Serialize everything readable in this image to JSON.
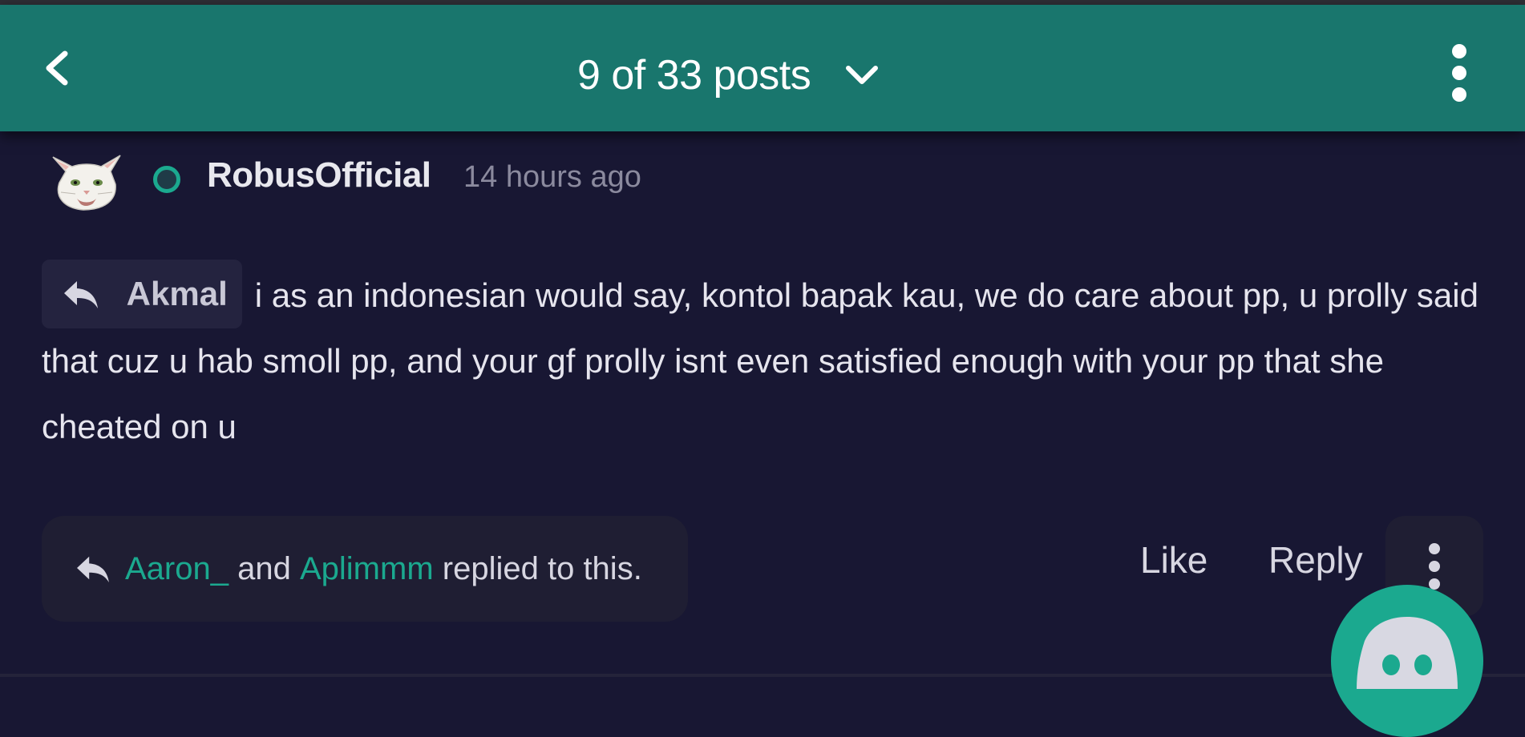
{
  "header": {
    "title": "9 of 33 posts",
    "back_icon": "chevron-left-icon",
    "dropdown_icon": "chevron-down-icon",
    "more_icon": "vertical-ellipsis-icon",
    "background_color": "#19766d"
  },
  "post": {
    "author": "RobusOfficial",
    "time": "14 hours ago",
    "avatar": "white-cat-avatar",
    "status_color": "#1ba98f",
    "reply_to": {
      "icon": "reply-arrow-icon",
      "name": "Akmal"
    },
    "text": "i as an indonesian would say, kontol bapak kau, we do care about pp, u prolly said that cuz u hab smoll pp, and your gf prolly isnt even satisfied enough with your pp that she cheated on u",
    "replies": {
      "icon": "reply-arrow-icon",
      "users": [
        "Aaron_",
        "Aplimmm"
      ],
      "connector": "and",
      "suffix": "replied to this."
    },
    "actions": {
      "like": "Like",
      "reply": "Reply",
      "more_icon": "vertical-ellipsis-icon"
    }
  },
  "fab": {
    "icon": "discord-icon",
    "color": "#1ba98f"
  },
  "colors": {
    "background": "#181733",
    "accent": "#1ba98f",
    "muted_text": "#8b8a9e"
  }
}
